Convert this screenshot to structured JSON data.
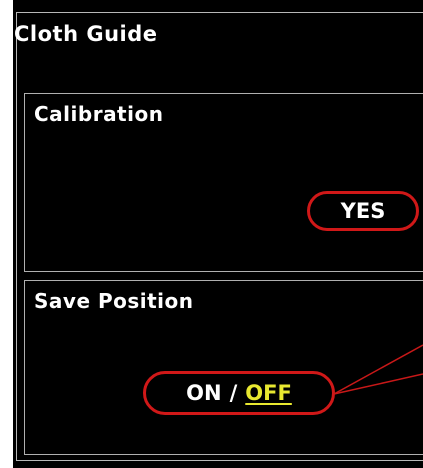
{
  "screen": {
    "title": "Cloth Guide"
  },
  "calibration": {
    "title": "Calibration",
    "button_label": "YES"
  },
  "save_position": {
    "title": "Save Position",
    "option_on": "ON",
    "separator": "/",
    "option_off": "OFF",
    "selected": "OFF"
  },
  "colors": {
    "background": "#000000",
    "highlight_ring": "#d01818",
    "selected_option": "#e8e830",
    "border": "#b0b0b0"
  }
}
